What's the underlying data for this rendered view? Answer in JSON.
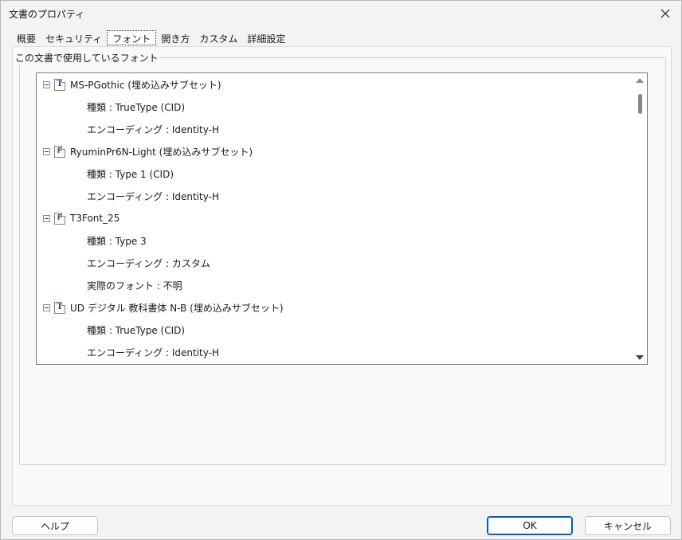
{
  "window": {
    "title": "文書のプロパティ"
  },
  "tabs": [
    {
      "label": "概要"
    },
    {
      "label": "セキュリティ"
    },
    {
      "label": "フォント",
      "selected": true
    },
    {
      "label": "開き方"
    },
    {
      "label": "カスタム"
    },
    {
      "label": "詳細設定"
    }
  ],
  "fonts_group": {
    "label": "この文書で使用しているフォント"
  },
  "font_tree": [
    {
      "name": "MS-PGothic (埋め込みサブセット)",
      "icon": "truetype-font-icon",
      "props": [
        "種類 : TrueType (CID)",
        "エンコーディング : Identity-H"
      ]
    },
    {
      "name": "RyuminPr6N-Light (埋め込みサブセット)",
      "icon": "type1-font-icon",
      "props": [
        "種類 : Type 1 (CID)",
        "エンコーディング : Identity-H"
      ]
    },
    {
      "name": "T3Font_25",
      "icon": "type1-font-icon",
      "props": [
        "種類 : Type 3",
        "エンコーディング : カスタム",
        "実際のフォント : 不明"
      ]
    },
    {
      "name": "UD デジタル 教科書体 N-B (埋め込みサブセット)",
      "icon": "truetype-font-icon",
      "props": [
        "種類 : TrueType (CID)",
        "エンコーディング : Identity-H"
      ]
    }
  ],
  "buttons": {
    "help": "ヘルプ",
    "ok": "OK",
    "cancel": "キャンセル"
  }
}
